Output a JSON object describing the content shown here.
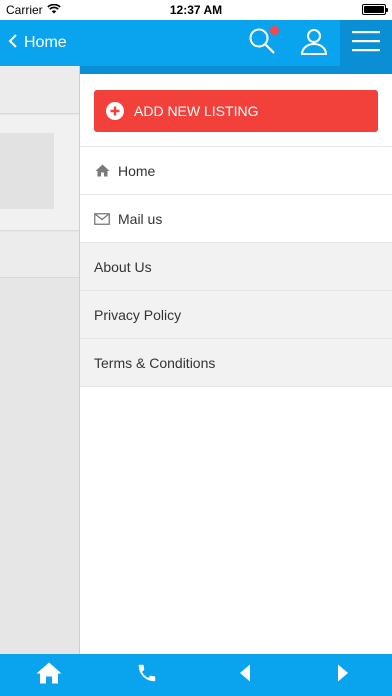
{
  "status_bar": {
    "carrier": "Carrier",
    "time": "12:37 AM"
  },
  "header": {
    "back_label": "Home",
    "has_notification": true
  },
  "drawer": {
    "add_listing_label": "ADD NEW LISTING",
    "items": [
      {
        "label": "Home",
        "icon": "home-icon"
      },
      {
        "label": "Mail us",
        "icon": "mail-icon"
      },
      {
        "label": "About Us"
      },
      {
        "label": "Privacy Policy"
      },
      {
        "label": "Terms & Conditions"
      }
    ]
  },
  "bottom_bar": {
    "icons": [
      "home-icon",
      "phone-icon",
      "back-arrow-icon",
      "forward-arrow-icon"
    ]
  },
  "colors": {
    "primary": "#0aa3ee",
    "primary_dark": "#0b8fd4",
    "accent": "#f2403b"
  }
}
